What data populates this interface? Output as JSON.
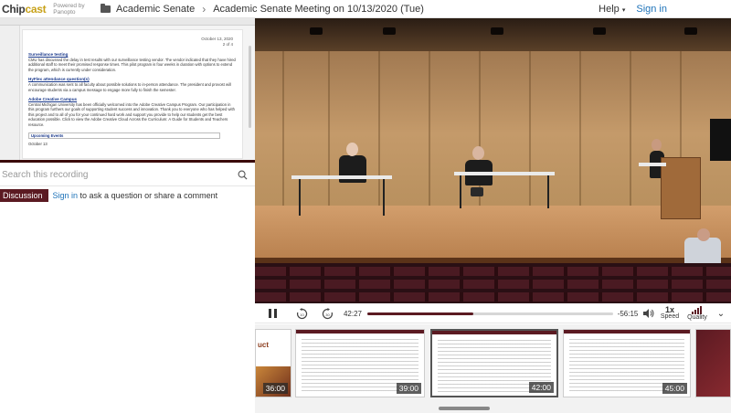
{
  "header": {
    "logo_prefix": "Chip",
    "logo_accent": "cast",
    "powered_line1": "Powered by",
    "powered_line2": "Panopto",
    "folder": "Academic Senate",
    "title": "Academic Senate Meeting on 10/13/2020 (Tue)",
    "help": "Help",
    "signin": "Sign in"
  },
  "slide": {
    "date": "October 13, 2020",
    "page": "2 of 4",
    "sections": [
      {
        "title": "Surveillance testing",
        "body": "CMU has discussed the delay in test results with our surveillance testing vendor. The vendor indicated that they have hired additional staff to meet their promised response times. This pilot program is four weeks in duration with options to extend the program, which is currently under consideration."
      },
      {
        "title": "HyFlex attendance question(s)",
        "body": "A communication was sent to all faculty about possible solutions to in-person attendance. The president and provost will encourage students via a campus message to engage more fully to finish the semester."
      },
      {
        "title": "Adobe Creative Campus",
        "body": "Central Michigan University has been officially welcomed into the Adobe Creative Campus Program. Our participation in this program furthers our goals of supporting student success and innovation. Thank you to everyone who has helped with this project and to all of you for your continued hard work and support you provide to help our students get the best education possible. Click to view the Adobe Creative Cloud Across the Curriculum: A Guide for Students and Teachers resource."
      }
    ],
    "upcoming": "Upcoming Events",
    "next_item": "October 13"
  },
  "search": {
    "placeholder": "Search this recording"
  },
  "discussion": {
    "tab": "Discussion",
    "signin": "Sign in",
    "text": " to ask a question or share a comment"
  },
  "controls": {
    "elapsed": "42:27",
    "remaining": "-56:15",
    "progress_fraction": 0.43,
    "speed_value": "1x",
    "speed_label": "Speed",
    "quality_label": "Quality"
  },
  "thumbnails": [
    {
      "label": "uct",
      "time": "36:00"
    },
    {
      "label": "",
      "time": "39:00"
    },
    {
      "label": "",
      "time": "42:00"
    },
    {
      "label": "",
      "time": "45:00"
    }
  ],
  "colors": {
    "accent": "#5b1a22",
    "link": "#1e73b9",
    "logo_gold": "#c8a21a"
  }
}
